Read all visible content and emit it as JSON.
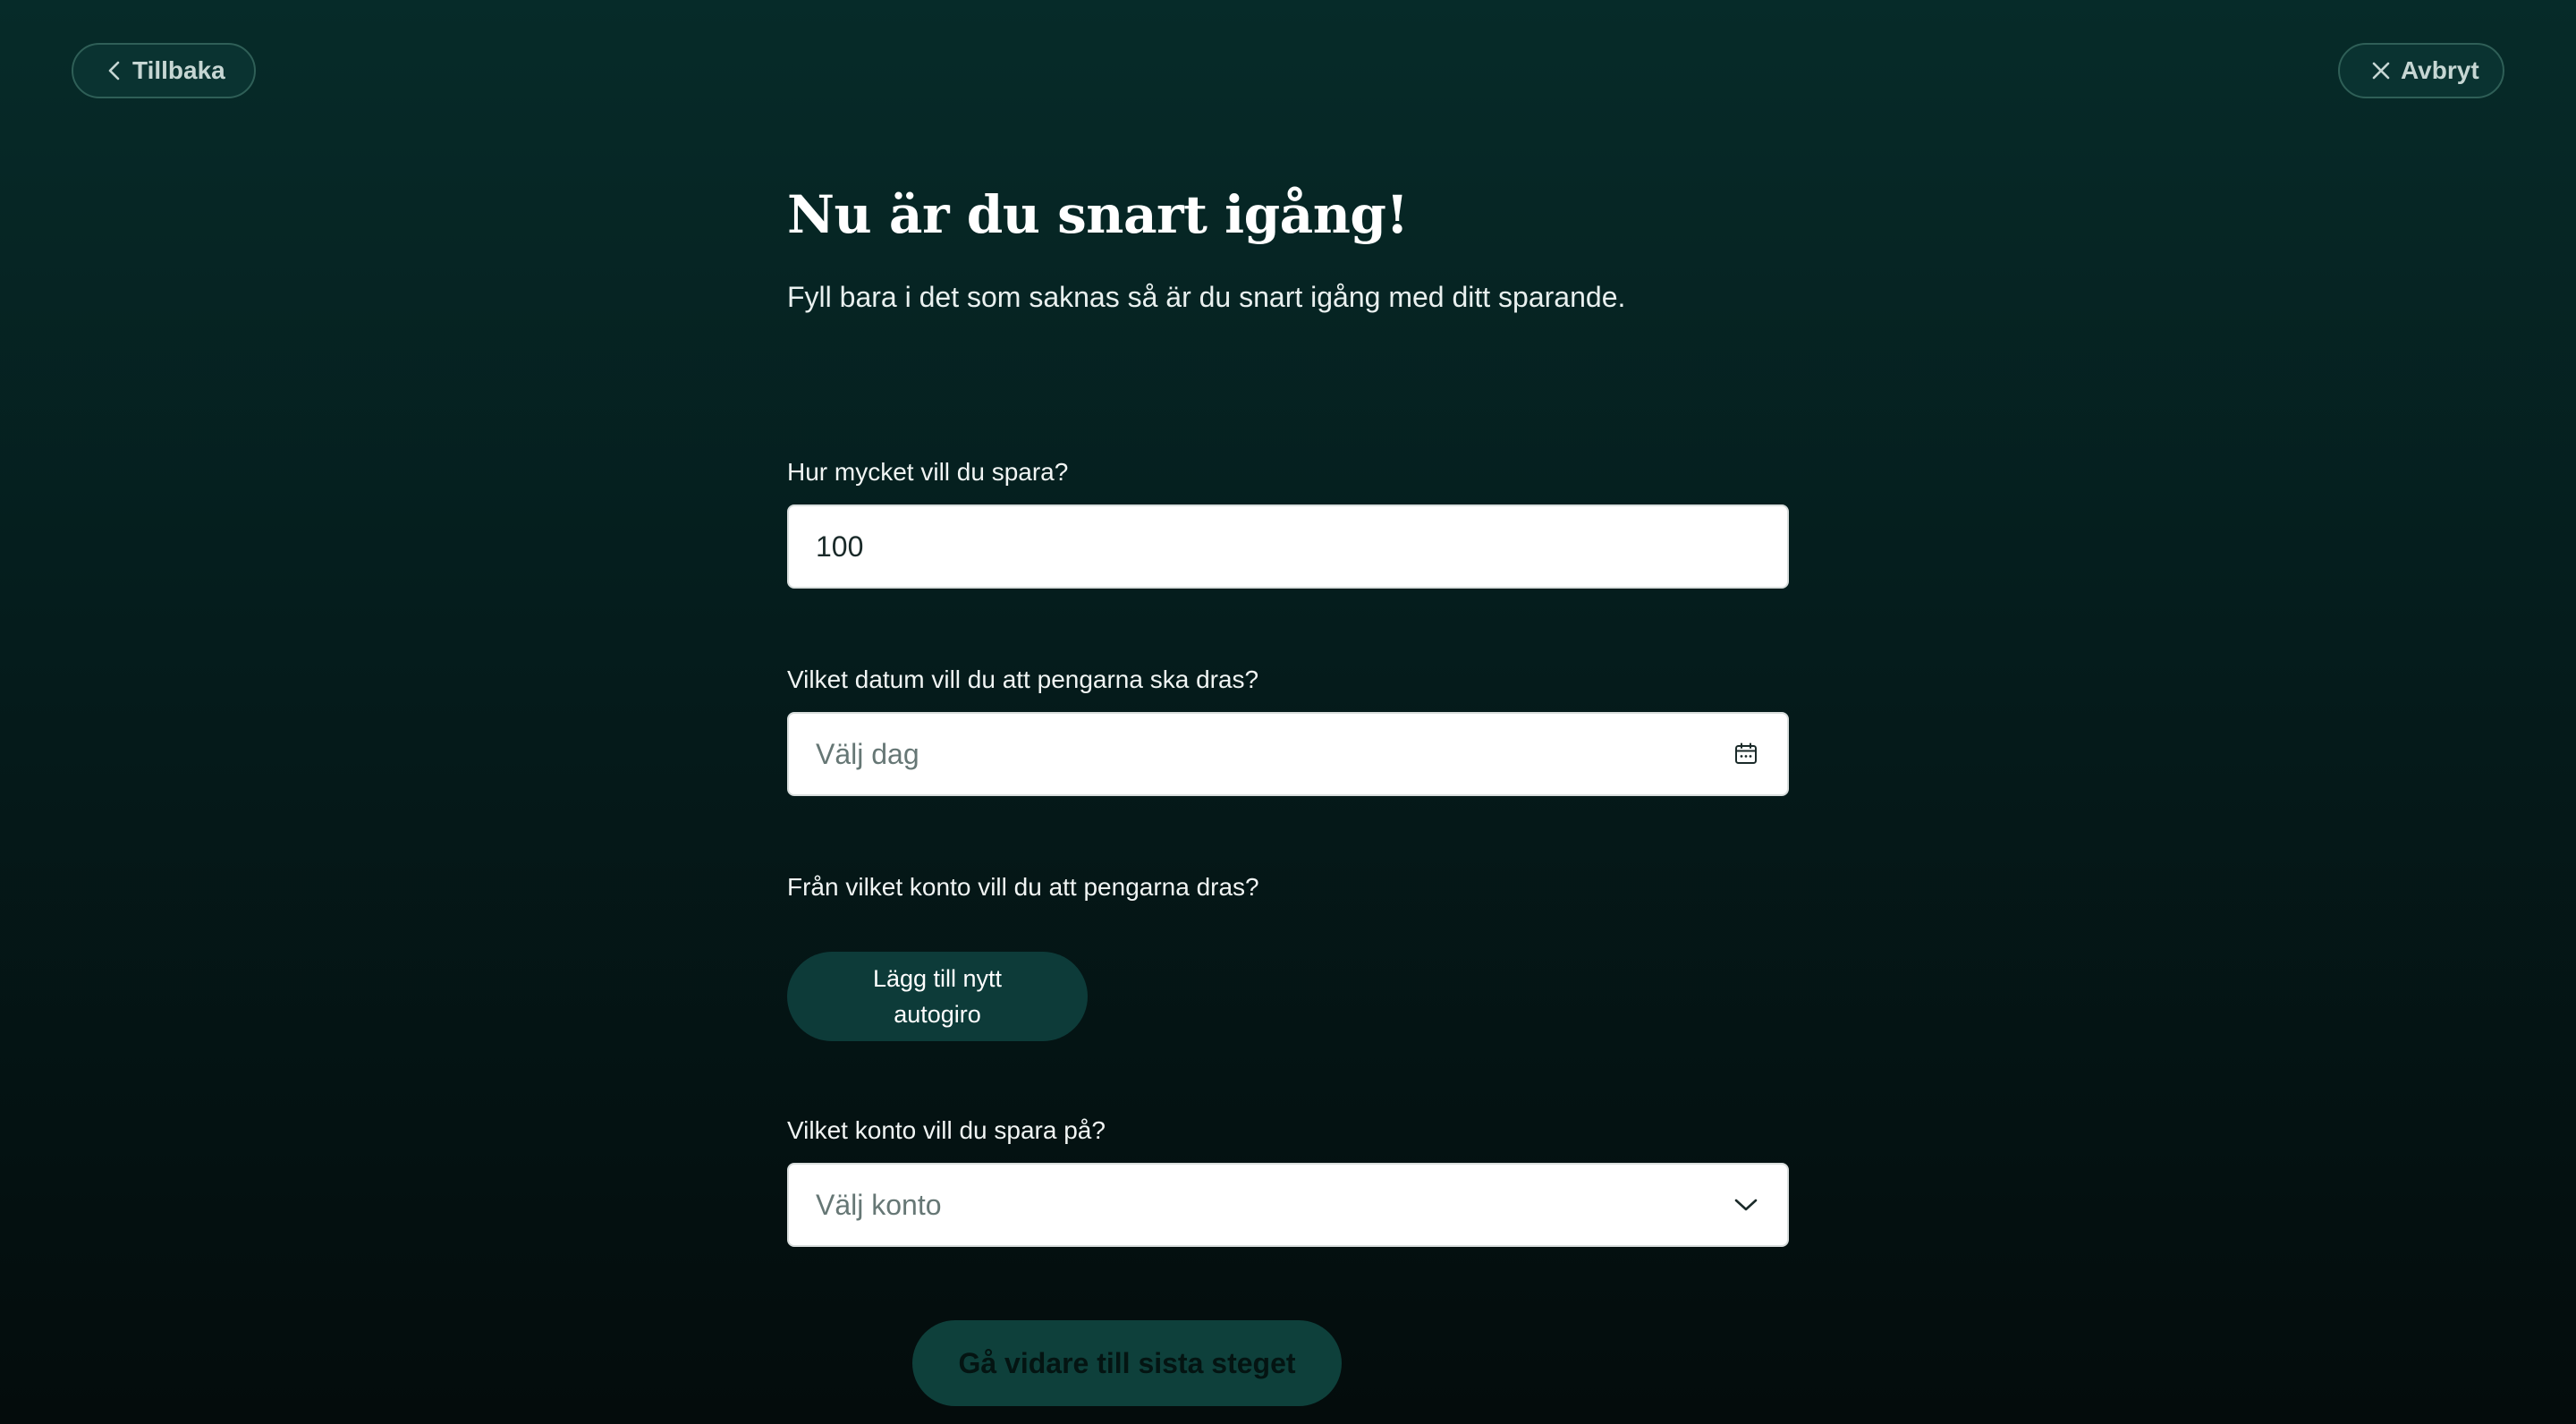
{
  "nav": {
    "back_label": "Tillbaka",
    "cancel_label": "Avbryt"
  },
  "header": {
    "title": "Nu är du snart igång!",
    "subtitle": "Fyll bara i det som saknas så är du snart igång med ditt sparande."
  },
  "form": {
    "amount": {
      "label": "Hur mycket vill du spara?",
      "value": "100"
    },
    "date": {
      "label": "Vilket datum vill du att pengarna ska dras?",
      "placeholder": "Välj dag",
      "icon": "calendar-icon"
    },
    "source_account": {
      "label": "Från vilket konto vill du att pengarna dras?",
      "button_label": "Lägg till nytt autogiro"
    },
    "target_account": {
      "label": "Vilket konto vill du spara på?",
      "placeholder": "Välj konto",
      "icon": "chevron-down-icon"
    },
    "submit_label": "Gå vidare till sista steget"
  },
  "colors": {
    "background_top": "#062b29",
    "background_bottom": "#040c0c",
    "primary_button": "#0e403b",
    "secondary_button": "#0d3b39"
  }
}
